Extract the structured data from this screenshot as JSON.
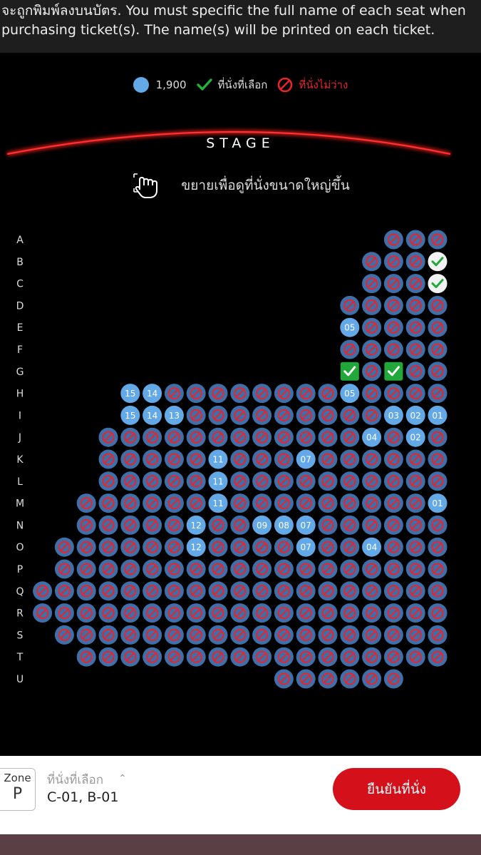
{
  "notice": {
    "text": "จะถูกพิมพ์ลงบนบัตร. You must specific the full name of each seat when\npurchasing ticket(s). The name(s) will be printed on each ticket."
  },
  "legend": {
    "price": "1,900",
    "selected": "ที่นั่งที่เลือก",
    "unavailable": "ที่นั่งไม่ว่าง",
    "colors": {
      "available": "#63a8e7",
      "selected": "#22a83a",
      "unavailable": "#e8242c",
      "taken_seat": "#3e6fa8"
    }
  },
  "stage": {
    "label": "STAGE"
  },
  "zoom_hint": {
    "text": "ขยายเพื่อดูที่นั่งขนาดใหญ่ขึ้น"
  },
  "seatmap": {
    "rows": [
      "A",
      "B",
      "C",
      "D",
      "E",
      "F",
      "G",
      "H",
      "I",
      "J",
      "K",
      "L",
      "M",
      "N",
      "O",
      "P",
      "Q",
      "R",
      "S",
      "T",
      "U"
    ],
    "row_seats": {
      "A": [
        "x",
        "x",
        "x"
      ],
      "B": [
        "x",
        "x",
        "x",
        "s"
      ],
      "C": [
        "x",
        "x",
        "x",
        "s"
      ],
      "D": [
        "x",
        "x",
        "x",
        "x",
        "x"
      ],
      "E": [
        "05",
        "x",
        "x",
        "x",
        "x"
      ],
      "F": [
        "x",
        "x",
        "x",
        "x",
        "x"
      ],
      "G": [
        "g",
        "x",
        "g",
        "x",
        "x"
      ],
      "H": [
        "15",
        "14",
        "x",
        "x",
        "x",
        "x",
        "x",
        "x",
        "x",
        "x",
        "05",
        "x",
        "x",
        "x",
        "x"
      ],
      "I": [
        "15",
        "14",
        "13",
        "x",
        "x",
        "x",
        "x",
        "x",
        "x",
        "x",
        "x",
        "x",
        "03",
        "02",
        "01"
      ],
      "J": [
        "x",
        "x",
        "x",
        "x",
        "x",
        "x",
        "x",
        "x",
        "x",
        "x",
        "x",
        "x",
        "04",
        "x",
        "02",
        "x"
      ],
      "K": [
        "x",
        "x",
        "x",
        "x",
        "x",
        "11",
        "x",
        "x",
        "x",
        "07",
        "x",
        "x",
        "x",
        "x",
        "x",
        "x"
      ],
      "L": [
        "x",
        "x",
        "x",
        "x",
        "x",
        "11",
        "x",
        "x",
        "x",
        "x",
        "x",
        "x",
        "x",
        "x",
        "x",
        "x"
      ],
      "M": [
        "x",
        "x",
        "x",
        "x",
        "x",
        "x",
        "11",
        "x",
        "x",
        "x",
        "x",
        "x",
        "x",
        "x",
        "x",
        "x",
        "01"
      ],
      "N": [
        "x",
        "x",
        "x",
        "x",
        "x",
        "12",
        "x",
        "x",
        "09",
        "08",
        "07",
        "x",
        "x",
        "x",
        "x",
        "x",
        "x"
      ],
      "O": [
        "x",
        "x",
        "x",
        "x",
        "x",
        "x",
        "12",
        "x",
        "x",
        "x",
        "x",
        "07",
        "x",
        "x",
        "04",
        "x",
        "x",
        "x"
      ],
      "P": [
        "x",
        "x",
        "x",
        "x",
        "x",
        "x",
        "x",
        "x",
        "x",
        "x",
        "x",
        "x",
        "x",
        "x",
        "x",
        "x",
        "x",
        "x"
      ],
      "Q": [
        "x",
        "x",
        "x",
        "x",
        "x",
        "x",
        "x",
        "x",
        "x",
        "x",
        "x",
        "x",
        "x",
        "x",
        "x",
        "x",
        "x",
        "x",
        "x"
      ],
      "R": [
        "x",
        "x",
        "x",
        "x",
        "x",
        "x",
        "x",
        "x",
        "x",
        "x",
        "x",
        "x",
        "x",
        "x",
        "x",
        "x",
        "x",
        "x",
        "x"
      ],
      "S": [
        "x",
        "x",
        "x",
        "x",
        "x",
        "x",
        "x",
        "x",
        "x",
        "x",
        "x",
        "x",
        "x",
        "x",
        "x",
        "x",
        "x",
        "x"
      ],
      "T": [
        "x",
        "x",
        "x",
        "x",
        "x",
        "x",
        "x",
        "x",
        "x",
        "x",
        "x",
        "x",
        "x",
        "x",
        "x",
        "x",
        "x"
      ],
      "U": [
        "x",
        "x",
        "x",
        "x",
        "x",
        "x"
      ]
    }
  },
  "footer": {
    "zone_label": "Zone",
    "zone_value": "P",
    "selected_label": "ที่นั่งที่เลือก",
    "selected_value": "C-01, B-01",
    "confirm_label": "ยืนยันที่นั่ง"
  }
}
